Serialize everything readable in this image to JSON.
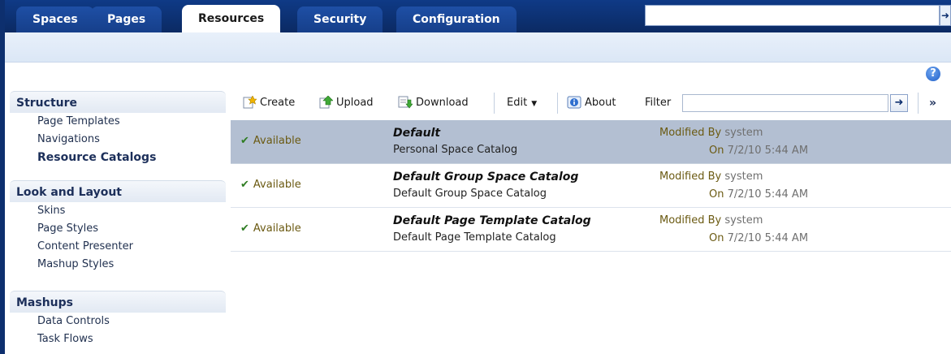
{
  "tabs": [
    "Spaces",
    "Pages",
    "Resources",
    "Security",
    "Configuration"
  ],
  "active_tab": "Resources",
  "colors": {
    "tab_bar": "#0b2a63",
    "selected_row": "#b3bfd2",
    "status_text": "#6b5a12",
    "check": "#2f7d23"
  },
  "sidebar": {
    "sections": [
      {
        "title": "Structure",
        "items": [
          "Page Templates",
          "Navigations",
          "Resource Catalogs"
        ]
      },
      {
        "title": "Look and Layout",
        "items": [
          "Skins",
          "Page Styles",
          "Content Presenter",
          "Mashup Styles"
        ]
      },
      {
        "title": "Mashups",
        "items": [
          "Data Controls",
          "Task Flows"
        ]
      }
    ],
    "selected_item": "Resource Catalogs"
  },
  "toolbar": {
    "create": "Create",
    "upload": "Upload",
    "download": "Download",
    "edit": "Edit",
    "about": "About",
    "filter_label": "Filter",
    "filter_value": "",
    "more": "»"
  },
  "catalogs": [
    {
      "status": "Available",
      "name": "Default",
      "description": "Personal Space Catalog",
      "modified_by_label": "Modified By",
      "modified_by": "system",
      "on_label": "On",
      "on": "7/2/10 5:44 AM",
      "selected": true
    },
    {
      "status": "Available",
      "name": "Default Group Space Catalog",
      "description": "Default Group Space Catalog",
      "modified_by_label": "Modified By",
      "modified_by": "system",
      "on_label": "On",
      "on": "7/2/10 5:44 AM",
      "selected": false
    },
    {
      "status": "Available",
      "name": "Default Page Template Catalog",
      "description": "Default Page Template Catalog",
      "modified_by_label": "Modified By",
      "modified_by": "system",
      "on_label": "On",
      "on": "7/2/10 5:44 AM",
      "selected": false
    }
  ],
  "icons": [
    "create-icon",
    "upload-icon",
    "download-icon",
    "edit-dropdown-icon",
    "about-icon",
    "filter-go-icon",
    "help-icon",
    "check-icon"
  ]
}
